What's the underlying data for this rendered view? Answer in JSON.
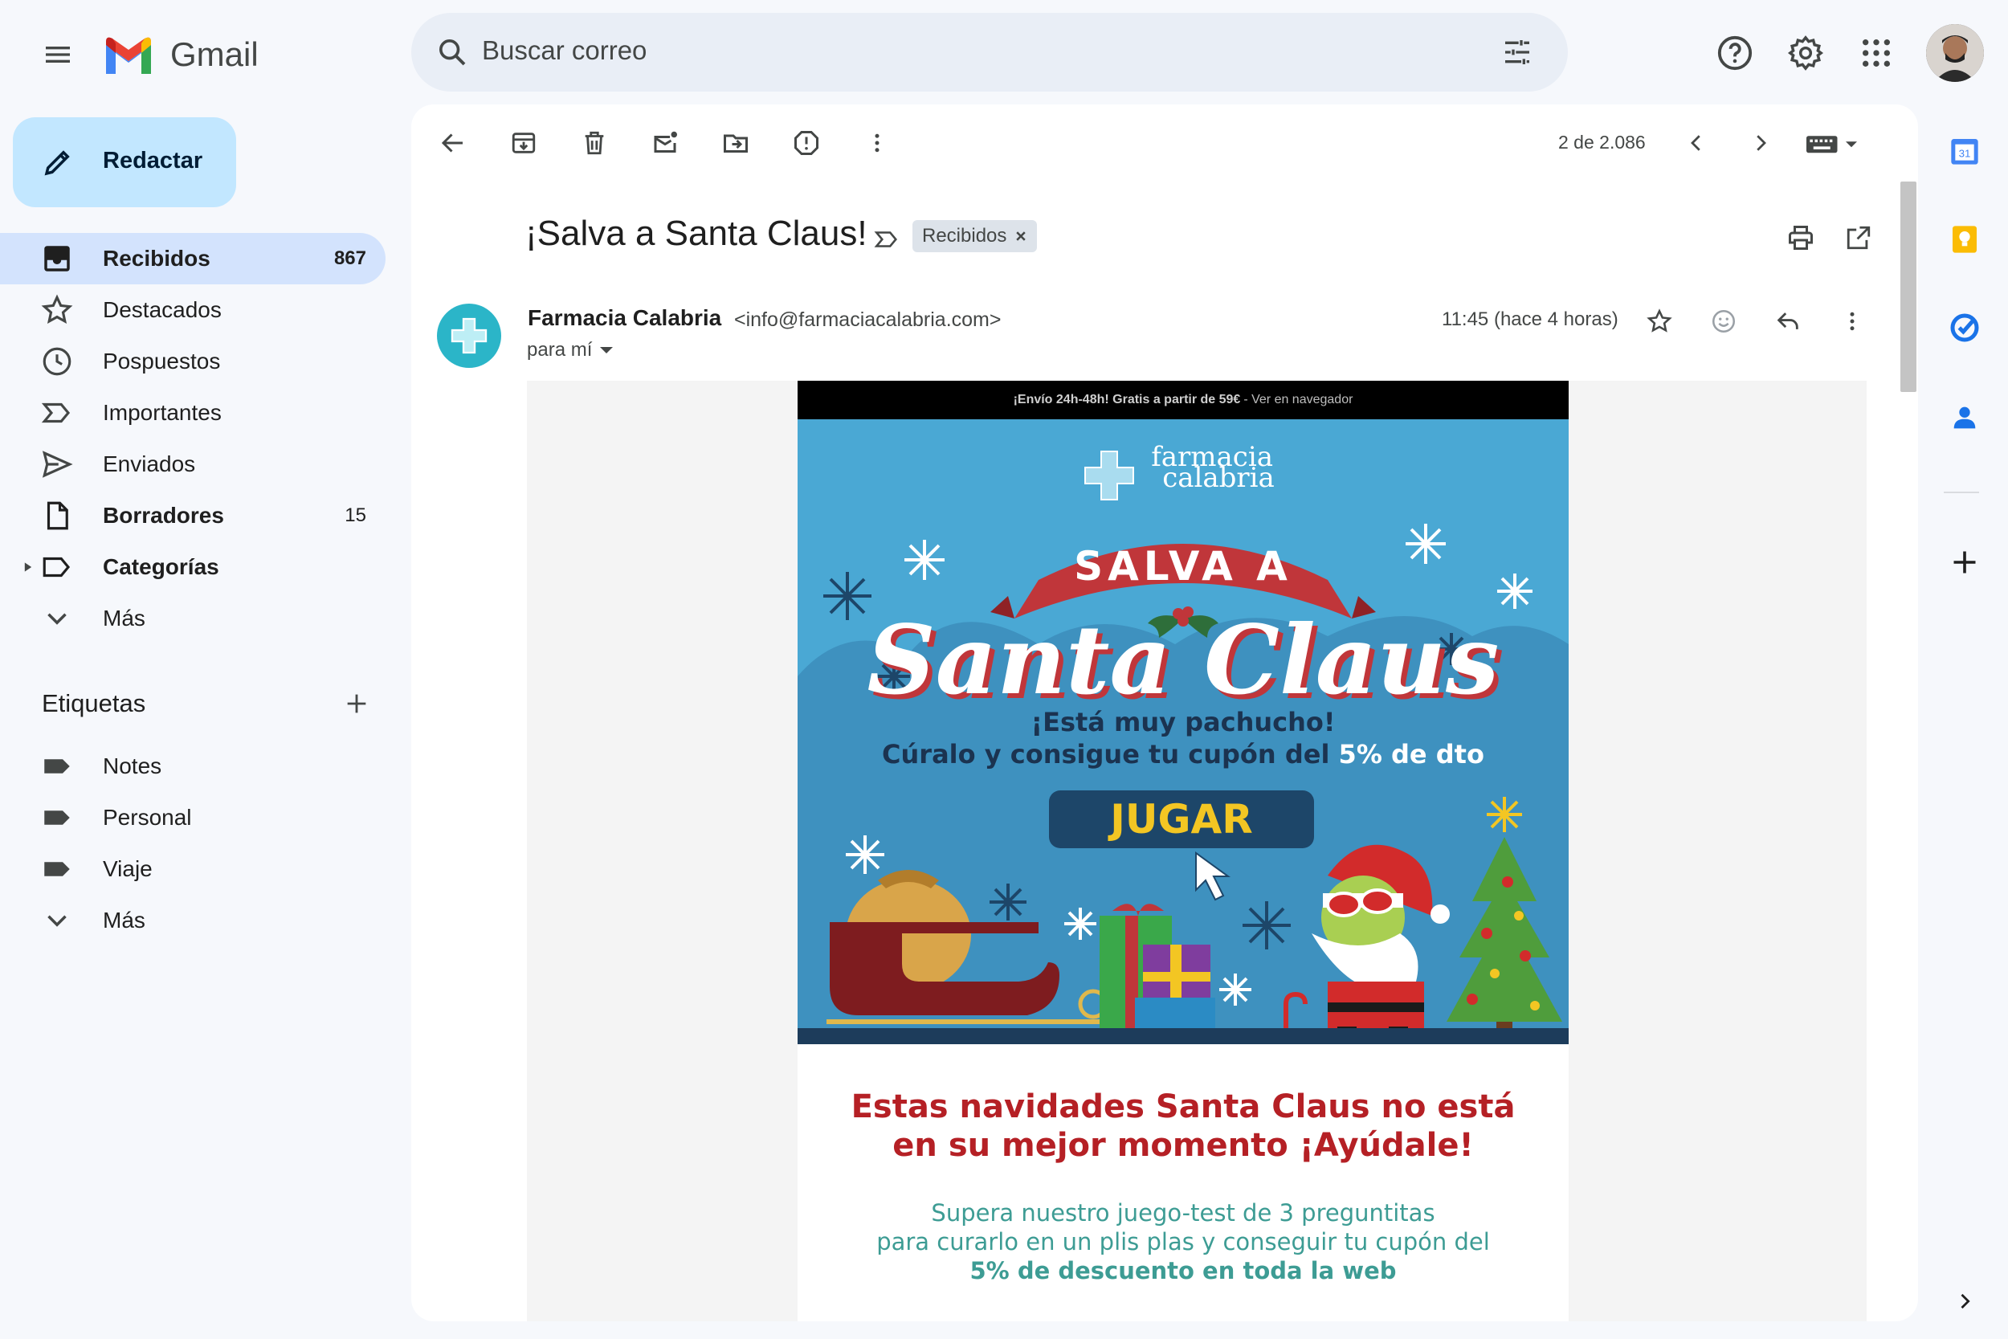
{
  "app": {
    "name": "Gmail"
  },
  "search": {
    "placeholder": "Buscar correo"
  },
  "compose": {
    "label": "Redactar"
  },
  "nav": {
    "items": [
      {
        "label": "Recibidos",
        "count": "867"
      },
      {
        "label": "Destacados",
        "count": ""
      },
      {
        "label": "Pospuestos",
        "count": ""
      },
      {
        "label": "Importantes",
        "count": ""
      },
      {
        "label": "Enviados",
        "count": ""
      },
      {
        "label": "Borradores",
        "count": "15"
      },
      {
        "label": "Categorías",
        "count": ""
      },
      {
        "label": "Más",
        "count": ""
      }
    ]
  },
  "labels": {
    "title": "Etiquetas",
    "items": [
      {
        "label": "Notes"
      },
      {
        "label": "Personal"
      },
      {
        "label": "Viaje"
      },
      {
        "label": "Más"
      }
    ]
  },
  "toolbar": {
    "page_count": "2 de 2.086"
  },
  "message": {
    "subject": "¡Salva a Santa Claus!",
    "label_chip": "Recibidos",
    "sender_name": "Farmacia Calabria",
    "sender_email": "<info@farmaciacalabria.com>",
    "recipient": "para mí",
    "timestamp": "11:45 (hace 4 horas)"
  },
  "email": {
    "preheader_bold": "¡Envío 24h-48h! Gratis a partir de 59€",
    "preheader_link": "- Ver en navegador",
    "brand_line1": "farmacia",
    "brand_line2": "calabria",
    "banner_text": "SALVA A",
    "title": "Santa Claus",
    "line1": "¡Está muy pachucho!",
    "line2": "Cúralo y consigue tu cupón del",
    "line2_highlight": "5% de dto",
    "cta": "JUGAR",
    "heading_line1": "Estas navidades Santa Claus no está",
    "heading_line2": "en su mejor momento ¡Ayúdale!",
    "para_line1": "Supera nuestro juego-test de 3 preguntitas",
    "para_line2": "para curarlo en un plis plas y conseguir tu cupón del",
    "para_line3": "5% de descuento en toda la web"
  },
  "icons": [
    "menu-icon",
    "search-icon",
    "search-options-icon",
    "help-icon",
    "settings-icon",
    "apps-icon",
    "pencil-icon",
    "inbox-icon",
    "star-icon",
    "clock-icon",
    "important-icon",
    "send-icon",
    "draft-icon",
    "label-icon",
    "chevron-down-icon",
    "plus-icon",
    "back-arrow-icon",
    "archive-icon",
    "delete-icon",
    "mark-unread-icon",
    "move-to-icon",
    "report-spam-icon",
    "more-vert-icon",
    "chevron-left-icon",
    "chevron-right-icon",
    "keyboard-icon",
    "print-icon",
    "open-in-new-icon",
    "emoji-icon",
    "reply-icon",
    "calendar-icon",
    "keep-icon",
    "tasks-icon",
    "contacts-icon"
  ],
  "colors": {
    "accent": "#0b57d0",
    "compose_bg": "#c2e7ff",
    "active_nav": "#d3e3fd",
    "hero_bg": "#4aa8d4",
    "cta_text": "#f3c623",
    "heading_red": "#b52025",
    "teal_text": "#3d9c94"
  }
}
